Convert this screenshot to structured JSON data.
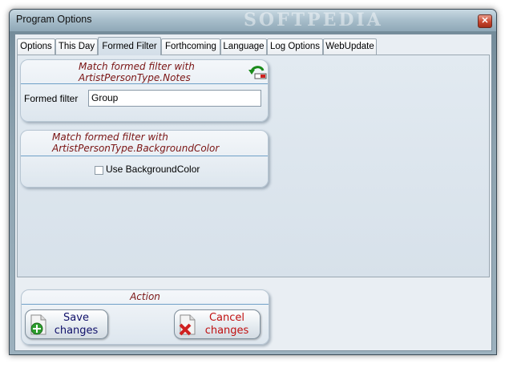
{
  "window": {
    "title": "Program Options",
    "watermark": "SOFTPEDIA"
  },
  "tabs": [
    {
      "label": "Options"
    },
    {
      "label": "This Day"
    },
    {
      "label": "Formed Filter"
    },
    {
      "label": "Forthcoming"
    },
    {
      "label": "Language"
    },
    {
      "label": "Log Options"
    },
    {
      "label": "WebUpdate"
    }
  ],
  "active_tab": "Formed Filter",
  "notes_group": {
    "title_line1": "Match formed filter with",
    "title_line2": "ArtistPersonType.Notes",
    "field_label": "Formed filter",
    "field_value": "Group",
    "undo_icon": "undo-arrow-icon"
  },
  "bgcolor_group": {
    "title_line1": "Match formed filter with",
    "title_line2": "ArtistPersonType.BackgroundColor",
    "checkbox_label": "Use BackgroundColor",
    "checkbox_checked": false
  },
  "action_group": {
    "title": "Action",
    "save_line1": "Save",
    "save_line2": "changes",
    "cancel_line1": "Cancel",
    "cancel_line2": "changes"
  },
  "colors": {
    "group_title": "#7a1414",
    "save_text": "#10106a",
    "cancel_text": "#c01010"
  }
}
